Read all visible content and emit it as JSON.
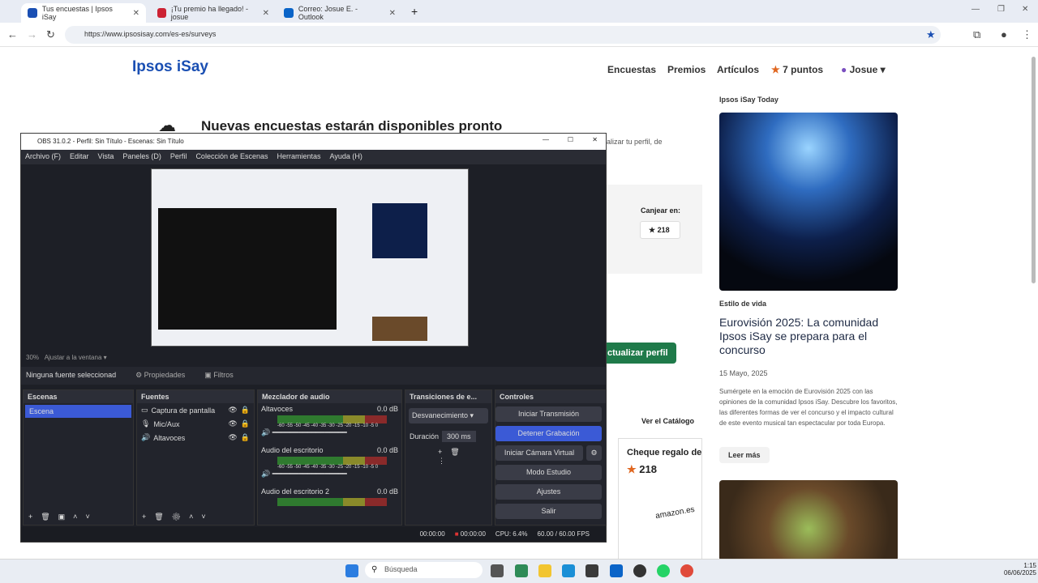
{
  "browser": {
    "tabs": [
      {
        "label": "Tus encuestas | Ipsos iSay"
      },
      {
        "label": "¡Tu premio ha llegado! - josue"
      },
      {
        "label": "Correo: Josue E. - Outlook"
      }
    ],
    "url": "https://www.ipsosisay.com/es-es/surveys"
  },
  "site": {
    "logo": "Ipsos",
    "logo_accent": "iSay",
    "nav": [
      "Encuestas",
      "Premios",
      "Artículos"
    ],
    "points": "7 puntos",
    "user": "Josue",
    "heading": "Nuevas encuestas estarán disponibles pronto",
    "profile_hint": "alizar tu perfil, de",
    "canjear_label": "Canjear en:",
    "canjear_value": "218",
    "update_profile": "ctualizar perfil",
    "catalog": "Ver el Catálogo",
    "cheque_title": "Cheque regalo de",
    "cheque_points": "218",
    "amazon": "amazon.es"
  },
  "sidebar": {
    "section": "Ipsos iSay Today",
    "category": "Estilo de vida",
    "title": "Eurovisión 2025: La comunidad Ipsos iSay se prepara para el concurso",
    "date": "15 Mayo, 2025",
    "description": "Sumérgete en la emoción de Eurovisión 2025 con las opiniones de la comunidad Ipsos iSay. Descubre los favoritos, las diferentes formas de ver el concurso y el impacto cultural de este evento musical tan espectacular por toda Europa.",
    "read_more": "Leer más"
  },
  "obs": {
    "title": "OBS 31.0.2 - Perfil: Sin Título - Escenas: Sin Título",
    "menu": [
      "Archivo (F)",
      "Editar",
      "Vista",
      "Paneles (D)",
      "Perfil",
      "Colección de Escenas",
      "Herramientas",
      "Ayuda (H)"
    ],
    "zoom": "30%",
    "fit": "Ajustar a la ventana",
    "no_source": "Ninguna fuente seleccionad",
    "properties": "Propiedades",
    "filters": "Filtros",
    "scenes_head": "Escenas",
    "scene": "Escena",
    "sources_head": "Fuentes",
    "sources": [
      "Captura de pantalla",
      "Mic/Aux",
      "Altavoces"
    ],
    "mixer_head": "Mezclador de audio",
    "mixer": [
      {
        "name": "Altavoces",
        "db": "0.0 dB"
      },
      {
        "name": "Audio del escritorio",
        "db": "0.0 dB"
      },
      {
        "name": "Audio del escritorio 2",
        "db": "0.0 dB"
      }
    ],
    "meter_ticks": "-60 -55 -50 -45 -40 -35 -30 -25 -20 -15 -10 -5 0",
    "transitions_head": "Transiciones de e...",
    "transition": "Desvanecimiento",
    "duration_label": "Duración",
    "duration": "300 ms",
    "controls_head": "Controles",
    "controls": [
      "Iniciar Transmisión",
      "Detener Grabación",
      "Iniciar Cámara Virtual",
      "Modo Estudio",
      "Ajustes",
      "Salir"
    ],
    "status": {
      "stream_time": "00:00:00",
      "rec_time": "00:00:00",
      "cpu": "CPU: 6.4%",
      "fps": "60.00 / 60.00 FPS"
    }
  },
  "taskbar": {
    "search": "Búsqueda",
    "time": "1:15",
    "date": "06/06/2025"
  }
}
